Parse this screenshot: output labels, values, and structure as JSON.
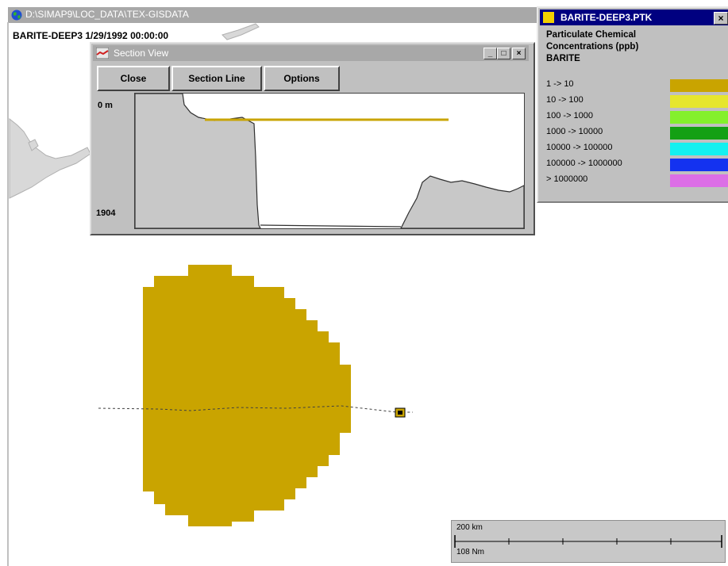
{
  "window": {
    "title": "D:\\SIMAP9\\LOC_DATA\\TEX-GISDATA",
    "map_caption": "BARITE-DEEP3 1/29/1992 00:00:00"
  },
  "section_view": {
    "title": "Section View",
    "buttons": {
      "close": "Close",
      "section_line": "Section Line",
      "options": "Options"
    },
    "depth_top": "0 m",
    "depth_bottom": "1904",
    "controls": {
      "minimize": "_",
      "maximize": "□",
      "close": "×"
    }
  },
  "legend": {
    "title": "BARITE-DEEP3.PTK",
    "close": "×",
    "heading_line1": "Particulate Chemical",
    "heading_line2": "Concentrations (ppb)",
    "heading_line3": "BARITE",
    "items": [
      {
        "label": "1 -> 10",
        "color": "#c9a400"
      },
      {
        "label": "10 -> 100",
        "color": "#e6e62e"
      },
      {
        "label": "100 -> 1000",
        "color": "#84f02c"
      },
      {
        "label": "1000 -> 10000",
        "color": "#14a014"
      },
      {
        "label": "10000 -> 100000",
        "color": "#14f0f0"
      },
      {
        "label": "100000 -> 1000000",
        "color": "#1432f0"
      },
      {
        "label": "> 1000000",
        "color": "#dc6ee6"
      }
    ]
  },
  "plume_color": "#c9a400",
  "scale_bar": {
    "km_label": "200 km",
    "nm_label": "108 Nm"
  }
}
